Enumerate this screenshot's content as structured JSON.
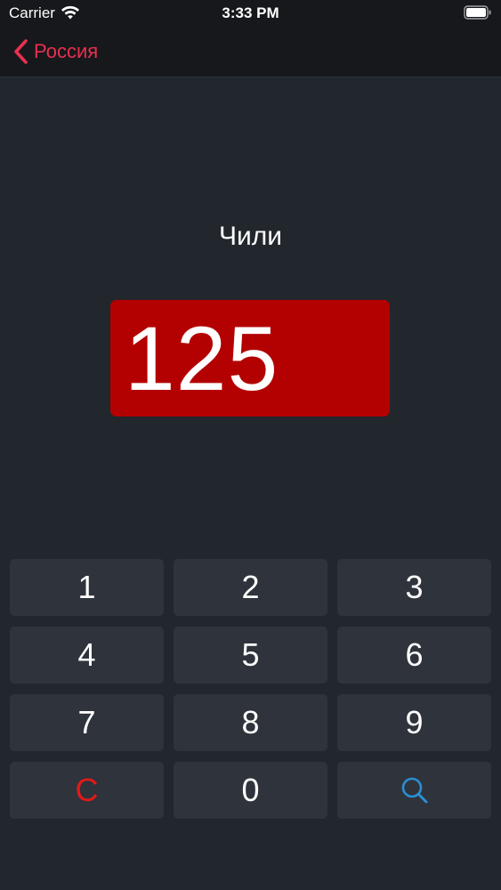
{
  "status_bar": {
    "carrier": "Carrier",
    "time": "3:33 PM",
    "wifi_icon": "wifi-icon",
    "battery_icon": "battery-icon"
  },
  "nav": {
    "back_label": "Россия",
    "back_icon": "chevron-left-icon",
    "accent_color": "#e8304f"
  },
  "main": {
    "country_name": "Чили",
    "code": "125",
    "code_background": "#b30000"
  },
  "keypad": {
    "keys": [
      "1",
      "2",
      "3",
      "4",
      "5",
      "6",
      "7",
      "8",
      "9",
      "C",
      "0"
    ],
    "clear_color": "#e01a1a",
    "search_icon": "search-icon",
    "search_color": "#2a8fd6"
  }
}
